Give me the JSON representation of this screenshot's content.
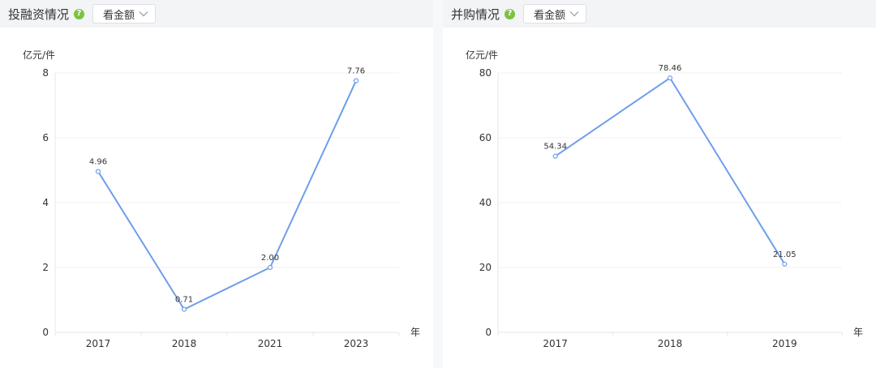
{
  "panels": [
    {
      "title": "投融资情况",
      "dropdown_value": "看金额"
    },
    {
      "title": "并购情况",
      "dropdown_value": "看金额"
    }
  ],
  "colors": {
    "line": "#6d9eeb",
    "axis": "#e5e7eb",
    "grid": "#f0f1f3",
    "text": "#333333",
    "help": "#7cc242"
  },
  "chart_data": [
    {
      "type": "line",
      "categories": [
        "2017",
        "2018",
        "2021",
        "2023"
      ],
      "values": [
        4.96,
        0.71,
        2.0,
        7.76
      ],
      "value_labels": [
        "4.96",
        "0.71",
        "2.00",
        "7.76"
      ],
      "yticks": [
        0,
        2,
        4,
        6,
        8
      ],
      "ylim": [
        0,
        8
      ],
      "ylabel": "亿元/件",
      "xlabel": "年",
      "grid": true
    },
    {
      "type": "line",
      "categories": [
        "2017",
        "2018",
        "2019"
      ],
      "values": [
        54.34,
        78.46,
        21.05
      ],
      "value_labels": [
        "54.34",
        "78.46",
        "21.05"
      ],
      "yticks": [
        0,
        20,
        40,
        60,
        80
      ],
      "ylim": [
        0,
        80
      ],
      "ylabel": "亿元/件",
      "xlabel": "年",
      "grid": true
    }
  ]
}
